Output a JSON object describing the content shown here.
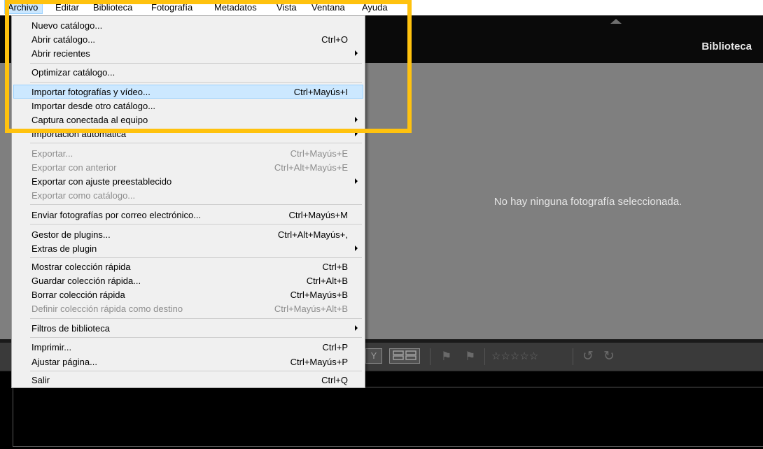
{
  "menubar": {
    "items": [
      "Archivo",
      "Editar",
      "Biblioteca",
      "Fotografía",
      "Metadatos",
      "Vista",
      "Ventana",
      "Ayuda"
    ]
  },
  "app": {
    "module_title": "Biblioteca",
    "empty_message": "No hay ninguna fotografía seleccionada."
  },
  "file_menu": {
    "items": [
      {
        "label": "Nuevo catálogo...",
        "shortcut": ""
      },
      {
        "label": "Abrir catálogo...",
        "shortcut": "Ctrl+O"
      },
      {
        "label": "Abrir recientes",
        "shortcut": "",
        "submenu": true
      },
      {
        "label": "Optimizar catálogo...",
        "shortcut": ""
      },
      {
        "label": "Importar fotografías y vídeo...",
        "shortcut": "Ctrl+Mayús+I",
        "highlighted": true
      },
      {
        "label": "Importar desde otro catálogo...",
        "shortcut": ""
      },
      {
        "label": "Captura conectada al equipo",
        "shortcut": "",
        "submenu": true
      },
      {
        "label": "Importación automática",
        "shortcut": "",
        "submenu": true,
        "partially_hidden": true
      },
      {
        "label": "Exportar...",
        "shortcut": "Ctrl+Mayús+E",
        "disabled": true
      },
      {
        "label": "Exportar con anterior",
        "shortcut": "Ctrl+Alt+Mayús+E",
        "disabled": true
      },
      {
        "label": "Exportar con ajuste preestablecido",
        "shortcut": "",
        "submenu": true
      },
      {
        "label": "Exportar como catálogo...",
        "shortcut": "",
        "disabled": true
      },
      {
        "label": "Enviar fotografías por correo electrónico...",
        "shortcut": "Ctrl+Mayús+M"
      },
      {
        "label": "Gestor de plugins...",
        "shortcut": "Ctrl+Alt+Mayús+,"
      },
      {
        "label": "Extras de plugin",
        "shortcut": "",
        "submenu": true
      },
      {
        "label": "Mostrar colección rápida",
        "shortcut": "Ctrl+B"
      },
      {
        "label": "Guardar colección rápida...",
        "shortcut": "Ctrl+Alt+B"
      },
      {
        "label": "Borrar colección rápida",
        "shortcut": "Ctrl+Mayús+B"
      },
      {
        "label": "Definir colección rápida como destino",
        "shortcut": "Ctrl+Mayús+Alt+B",
        "disabled": true
      },
      {
        "label": "Filtros de biblioteca",
        "shortcut": "",
        "submenu": true
      },
      {
        "label": "Imprimir...",
        "shortcut": "Ctrl+P"
      },
      {
        "label": "Ajustar página...",
        "shortcut": "Ctrl+Mayús+P"
      },
      {
        "label": "Salir",
        "shortcut": "Ctrl+Q"
      }
    ]
  },
  "toolbar": {
    "view_button_glyph": "Y",
    "rating_stars": "☆☆☆☆☆",
    "flag_glyph": "⚑",
    "rotate_left_glyph": "↺",
    "rotate_right_glyph": "↻"
  },
  "colors": {
    "annotation_highlight": "#ffc20e",
    "menu_hover": "#cce8ff",
    "loupe_background": "#7f7f7f"
  }
}
